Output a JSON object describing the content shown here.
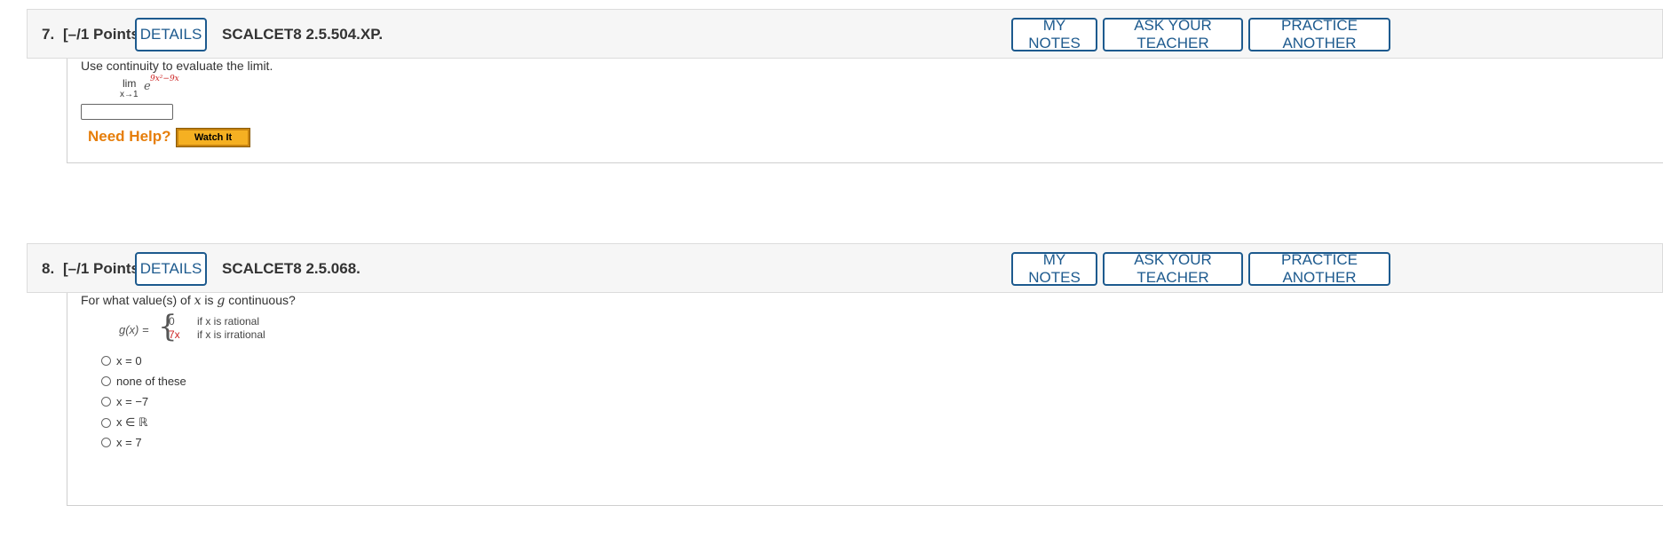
{
  "questions": [
    {
      "number": "7.",
      "points": "[–/1 Points]",
      "details_label": "DETAILS",
      "code": "SCALCET8 2.5.504.XP.",
      "my_notes_label": "MY NOTES",
      "ask_teacher_label": "ASK YOUR TEACHER",
      "practice_label": "PRACTICE ANOTHER",
      "prompt": "Use continuity to evaluate the limit.",
      "math": {
        "lim": "lim",
        "sub": "x→1",
        "base": "e",
        "exponent": "9x²−9x"
      },
      "answer_value": "",
      "need_help": "Need Help?",
      "watch_label": "Watch It"
    },
    {
      "number": "8.",
      "points": "[–/1 Points]",
      "details_label": "DETAILS",
      "code": "SCALCET8 2.5.068.",
      "my_notes_label": "MY NOTES",
      "ask_teacher_label": "ASK YOUR TEACHER",
      "practice_label": "PRACTICE ANOTHER",
      "prompt_parts": [
        "For what value(s) of ",
        "x",
        " is ",
        "g",
        " continuous?"
      ],
      "piecewise": {
        "lhs": "g(x) =",
        "case1_value": "0",
        "case1_cond": "if x is rational",
        "case2_value": "7x",
        "case2_cond": "if x is irrational"
      },
      "options": [
        "x = 0",
        "none of these",
        "x = −7",
        "x ∈ ℝ",
        "x = 7"
      ]
    }
  ],
  "colors": {
    "accent": "#1d5a8e",
    "help_orange": "#e67e0a",
    "watch_yellow": "#f5b022",
    "math_red": "#cc2222"
  }
}
